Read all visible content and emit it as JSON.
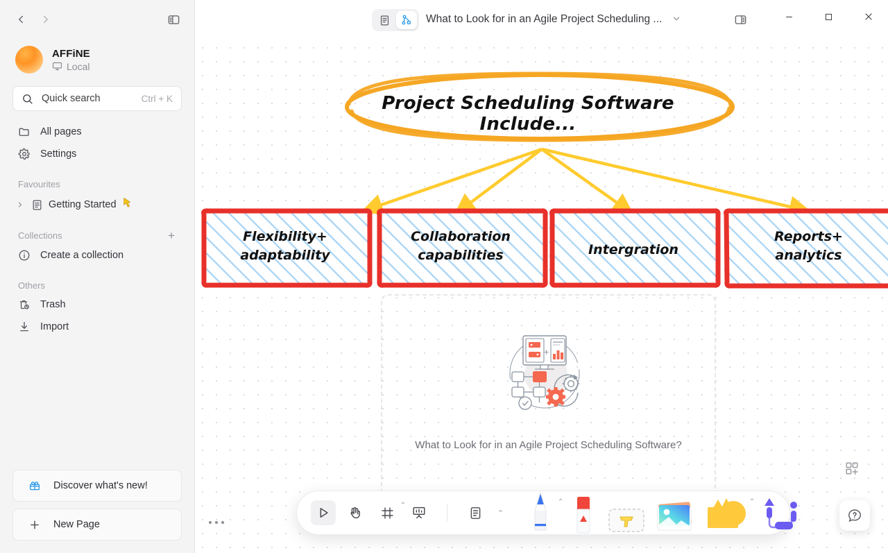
{
  "window": {
    "minimize_label": "Minimize",
    "maximize_label": "Maximize",
    "close_label": "Close"
  },
  "sidebar": {
    "back_label": "Back",
    "forward_label": "Forward",
    "collapse_label": "Collapse sidebar",
    "workspace": {
      "name": "AFFiNE",
      "sync_status": "Local"
    },
    "search": {
      "label": "Quick search",
      "shortcut": "Ctrl + K"
    },
    "nav_items": [
      {
        "label": "All pages",
        "icon": "folder-icon"
      },
      {
        "label": "Settings",
        "icon": "gear-icon"
      }
    ],
    "sections": [
      {
        "title": "Favourites"
      },
      {
        "title": "Collections",
        "action": "+"
      },
      {
        "title": "Others"
      }
    ],
    "favourites": [
      {
        "label": "Getting Started",
        "icon": "doc-icon"
      }
    ],
    "collections": [
      {
        "label": "Create a collection",
        "icon": "info-icon"
      }
    ],
    "others": [
      {
        "label": "Trash",
        "icon": "trash-icon"
      },
      {
        "label": "Import",
        "icon": "import-icon"
      }
    ],
    "footer": [
      {
        "label": "Discover what's new!",
        "icon": "gift-icon"
      },
      {
        "label": "New Page",
        "icon": "plus-icon"
      }
    ]
  },
  "titlebar": {
    "doc_title": "What to Look for in an Agile Project Scheduling ...",
    "mode_page_label": "Page mode",
    "mode_edgeless_label": "Edgeless mode",
    "active_mode": "edgeless",
    "title_menu_label": "Title options",
    "right_sidebar_label": "Toggle right sidebar"
  },
  "canvas": {
    "mindmap": {
      "root": {
        "text": "Project Scheduling Software Include...",
        "stroke": "#f5a623",
        "shape": "ellipse"
      },
      "children": [
        {
          "text": "Flexibility+\nadaptability",
          "line1": "Flexibility+",
          "line2": "adaptability",
          "stroke": "#e8302a",
          "fill": "hatch-blue"
        },
        {
          "text": "Collaboration\ncapabilities",
          "line1": "Collaboration",
          "line2": "capabilities",
          "stroke": "#e8302a",
          "fill": "hatch-blue"
        },
        {
          "text": "Intergration",
          "line1": "Intergration",
          "line2": "",
          "stroke": "#e8302a",
          "fill": "hatch-blue"
        },
        {
          "text": "Reports+\nanalytics",
          "line1": "Reports+",
          "line2": "analytics",
          "stroke": "#e8302a",
          "fill": "hatch-blue"
        }
      ],
      "connector_color": "#ffcb2e"
    },
    "note": {
      "caption": "What to Look for in an Agile Project Scheduling Software?",
      "illustration": "project-management-illustration"
    },
    "more_options_label": "More options"
  },
  "toolbar": {
    "tools": [
      {
        "name": "select-tool",
        "label": "Select",
        "active": true
      },
      {
        "name": "hand-tool",
        "label": "Hand / Pan",
        "active": false
      },
      {
        "name": "frame-tool",
        "label": "Frame",
        "active": false,
        "caret": true
      },
      {
        "name": "present-tool",
        "label": "Present",
        "active": false
      },
      {
        "name": "note-tool",
        "label": "Note",
        "active": false,
        "caret": true
      }
    ],
    "creators": [
      {
        "name": "pen-tool",
        "label": "Pen",
        "color": "#3b74f0",
        "caret": true
      },
      {
        "name": "eraser-tool",
        "label": "Eraser",
        "color": "#f0453a"
      },
      {
        "name": "text-tool",
        "label": "Text",
        "color": "#ffd84d"
      },
      {
        "name": "image-tool",
        "label": "Image"
      },
      {
        "name": "shape-tool",
        "label": "Shape",
        "color": "#ffc93c",
        "caret": true
      },
      {
        "name": "connector-tool",
        "label": "Connector",
        "color": "#6b5bf0"
      }
    ]
  },
  "overlays": {
    "add_widget_label": "Add widget",
    "help_label": "Help and feedback"
  },
  "colors": {
    "accent_orange": "#f5a623",
    "accent_red": "#e8302a",
    "accent_yellow": "#ffcb2e",
    "hatch_blue": "#a8d4f5",
    "sidebar_bg": "#f4f4f5"
  }
}
